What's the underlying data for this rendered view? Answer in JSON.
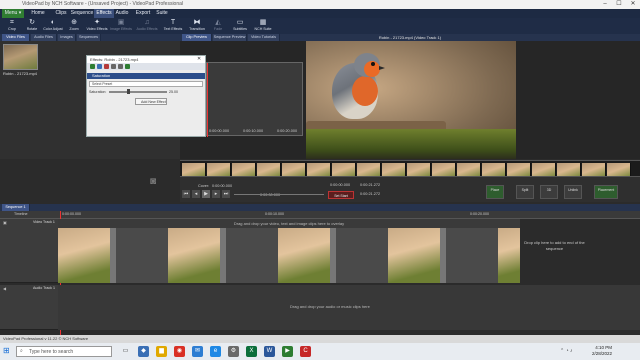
{
  "window": {
    "title": "VideoPad by NCH Software - (Unsaved Project) - VideoPad Professional"
  },
  "menu": {
    "items": [
      {
        "label": "Menu ▾"
      },
      {
        "label": "Home"
      },
      {
        "label": "Clips"
      },
      {
        "label": "Sequence"
      },
      {
        "label": "Effects"
      },
      {
        "label": "Audio"
      },
      {
        "label": "Export"
      },
      {
        "label": "Suite"
      }
    ],
    "active_index": 4
  },
  "toolbar": {
    "items": [
      {
        "label": "Crop",
        "icon": "crop-icon"
      },
      {
        "label": "Rotate",
        "icon": "rotate-icon"
      },
      {
        "label": "Color Adjust",
        "icon": "color-adjust-icon"
      },
      {
        "label": "Zoom",
        "icon": "zoom-icon"
      },
      {
        "label": "Video Effects",
        "icon": "video-effects-icon"
      },
      {
        "label": "Image Effects",
        "icon": "image-effects-icon"
      },
      {
        "label": "Audio Effects",
        "icon": "audio-effects-icon"
      },
      {
        "label": "Text Effects",
        "icon": "text-effects-icon"
      },
      {
        "label": "Transition",
        "icon": "transition-icon"
      },
      {
        "label": "Fade",
        "icon": "fade-icon"
      },
      {
        "label": "Subtitles",
        "icon": "subtitles-icon"
      },
      {
        "label": "NCH Suite",
        "icon": "nch-suite-icon"
      }
    ]
  },
  "bin_tabs": [
    {
      "label": "Video Files"
    },
    {
      "label": "Audio Files"
    },
    {
      "label": "Images"
    },
    {
      "label": "Sequences"
    }
  ],
  "bin": {
    "clip_name": "Robin - 21723.mp4"
  },
  "preview_tabs": [
    {
      "label": "Clip Preview"
    },
    {
      "label": "Sequence Preview"
    },
    {
      "label": "Video Tutorials"
    }
  ],
  "preview": {
    "title": "Robin - 21723.mp4 (Video Track 1)"
  },
  "effects_window": {
    "title": "Effects: Robin - 21723.mp4",
    "effect_name": "Saturation",
    "preset_label": "Select Preset",
    "param_label": "Saturation:",
    "param_value": "25.00",
    "add_button": "Add New Effect",
    "times": [
      "0:00:00.000",
      "0:00:10.000",
      "0:00:20.000"
    ]
  },
  "transport": {
    "cover_label": "Cover:",
    "cover_time": "0:00:00.000",
    "current_time": "0:00:00.000",
    "in_time": "0:00:00.000",
    "out_time": "0:00:21.272",
    "duration": "0:00:21.272",
    "set_start": "Set Start",
    "buttons": [
      "Place",
      "Split",
      "3D",
      "Unlink",
      "Placement"
    ]
  },
  "sequence": {
    "tab": "Sequence 1",
    "timeline_label": "Timeline",
    "ticks": [
      "0:00:00.000",
      "0:00:10.000",
      "0:00:20.000",
      "0:00:30.000"
    ]
  },
  "tracks": {
    "video": {
      "name": "Video Track 1",
      "overlay_hint": "Drag and drop your video, text and image clips here to overlay",
      "end_hint": "Drop clip here to add to end of the sequence"
    },
    "audio": {
      "name": "Audio Track 1",
      "hint": "Drag and drop your audio or music clips here"
    }
  },
  "status": {
    "text": "VideoPad Professional v 11.22 © NCH Software"
  },
  "taskbar": {
    "search_placeholder": "Type here to search",
    "time": "4:10 PM",
    "date": "2/28/2022"
  }
}
